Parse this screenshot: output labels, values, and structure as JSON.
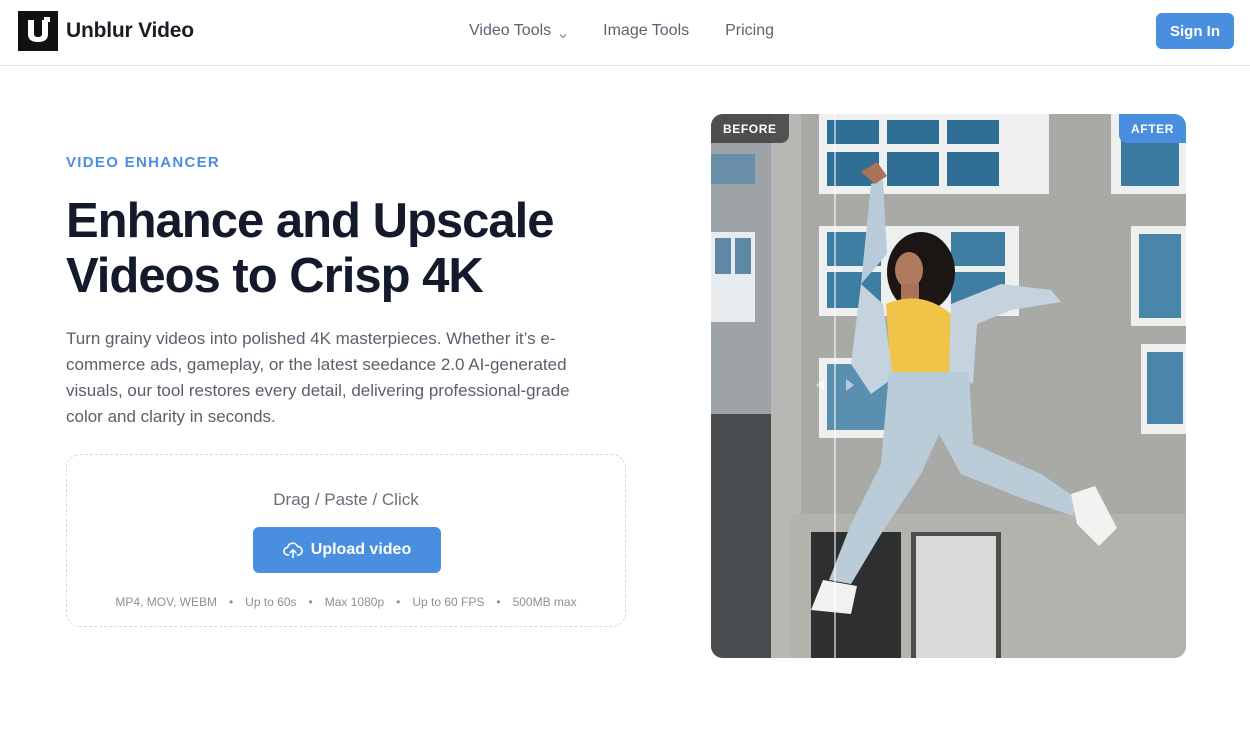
{
  "header": {
    "brand": "Unblur Video",
    "nav": [
      {
        "label": "Video Tools",
        "has_dropdown": true
      },
      {
        "label": "Image Tools"
      },
      {
        "label": "Pricing"
      }
    ],
    "signin_label": "Sign In"
  },
  "hero": {
    "eyebrow": "VIDEO ENHANCER",
    "title": "Enhance and Upscale Videos to Crisp 4K",
    "description": "Turn grainy videos into polished 4K masterpieces. Whether it’s e-commerce ads, gameplay, or the latest seedance 2.0 AI-generated visuals, our tool restores every detail, delivering professional-grade color and clarity in seconds.",
    "dropzone": {
      "hint": "Drag / Paste / Click",
      "button_label": "Upload video",
      "specs": [
        "MP4, MOV, WEBM",
        "Up to 60s",
        "Max 1080p",
        "Up to 60 FPS",
        "500MB max"
      ]
    },
    "comparison": {
      "before_label": "BEFORE",
      "after_label": "AFTER"
    }
  },
  "colors": {
    "accent": "#4a8ee0",
    "text_dark": "#141a2b",
    "text_muted": "#5a5f6b"
  },
  "icons": [
    "logo-icon",
    "chevron-down-icon",
    "upload-cloud-icon",
    "arrow-left-icon",
    "arrow-right-icon"
  ]
}
